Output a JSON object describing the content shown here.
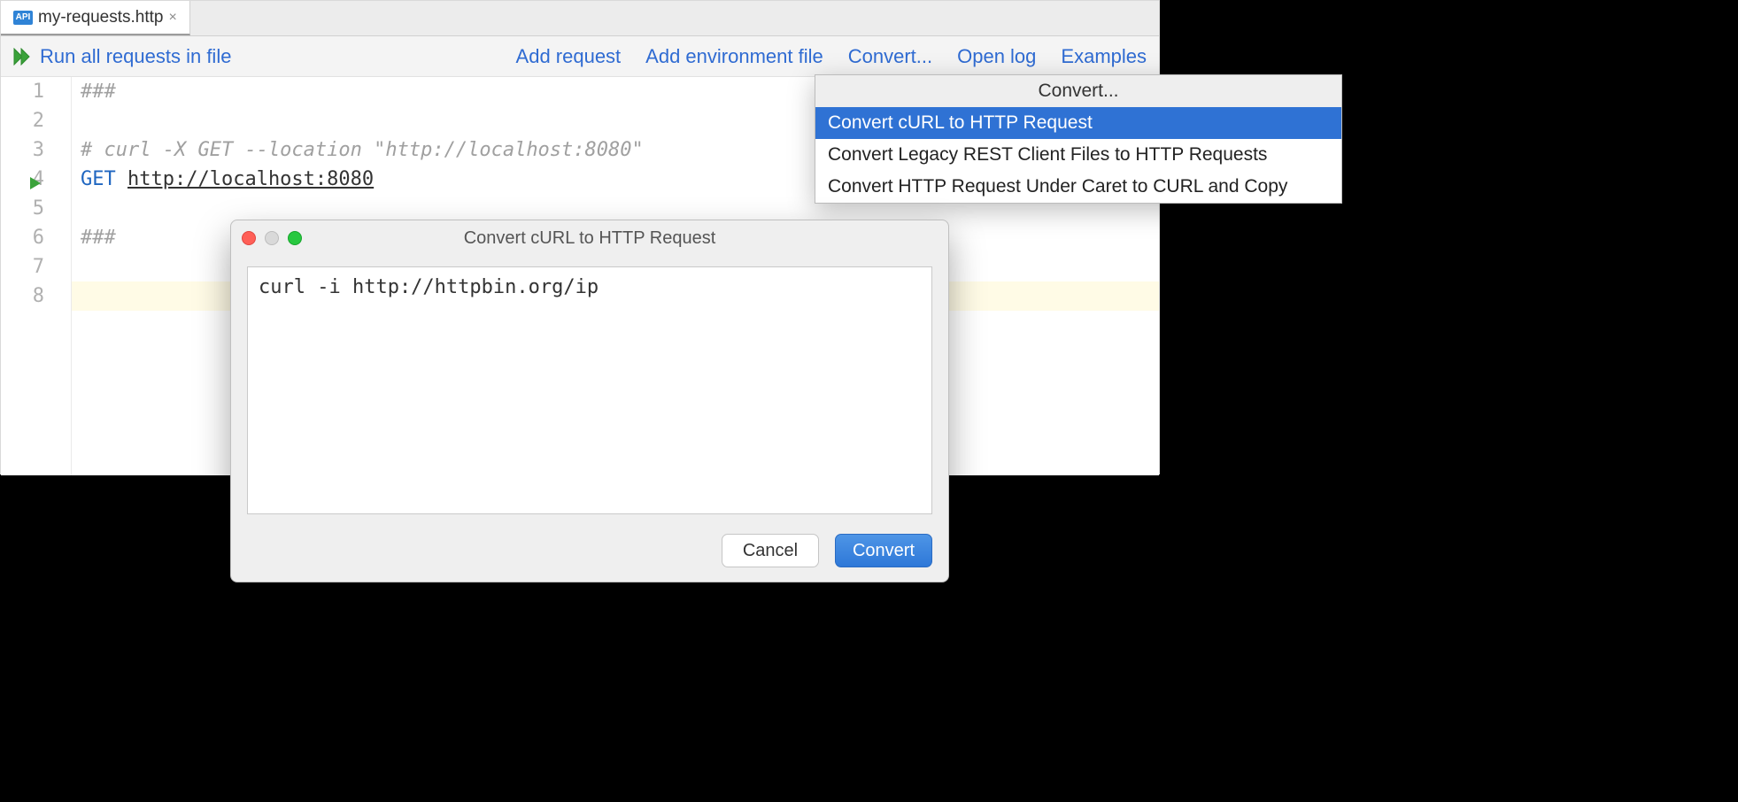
{
  "tab": {
    "icon_label": "API",
    "filename": "my-requests.http"
  },
  "toolbar": {
    "run_all": "Run all requests in file",
    "add_request": "Add request",
    "add_env": "Add environment file",
    "convert": "Convert...",
    "open_log": "Open log",
    "examples": "Examples"
  },
  "gutter": {
    "lines": [
      "1",
      "2",
      "3",
      "4",
      "5",
      "6",
      "7",
      "8"
    ],
    "run_marker_line": 4
  },
  "code": {
    "l1": "###",
    "l2": "",
    "l3_comment": "# curl -X GET --location \"http://localhost:8080\"",
    "l4_method": "GET",
    "l4_url": "http://localhost:8080",
    "l5": "",
    "l6": "###",
    "l7": "",
    "l8": ""
  },
  "menu": {
    "title": "Convert...",
    "items": [
      "Convert cURL to HTTP Request",
      "Convert Legacy REST Client Files to HTTP Requests",
      "Convert HTTP Request Under Caret to CURL and Copy"
    ],
    "selected_index": 0
  },
  "dialog": {
    "title": "Convert cURL to HTTP Request",
    "text": "curl -i http://httpbin.org/ip",
    "cancel": "Cancel",
    "convert": "Convert"
  }
}
